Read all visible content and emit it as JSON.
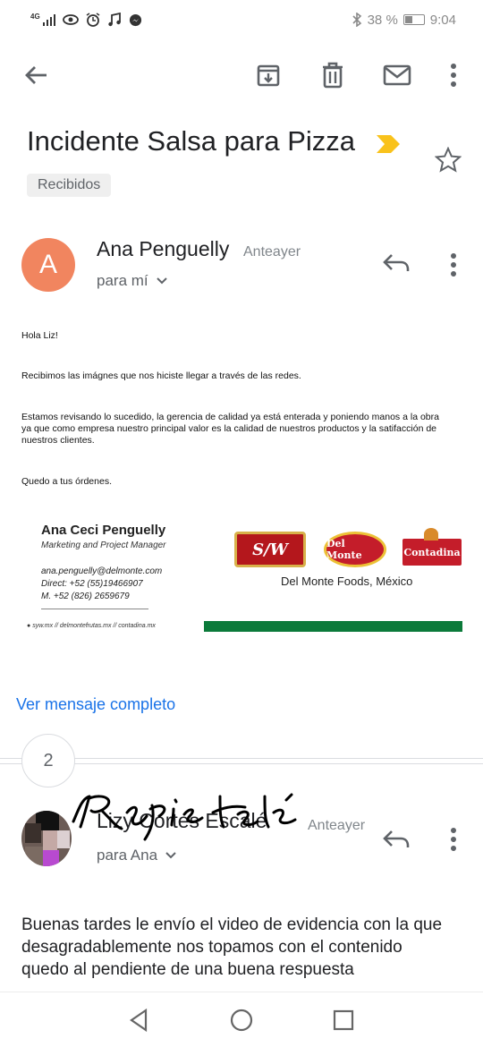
{
  "status_bar": {
    "network": "4G",
    "battery_text": "38 %",
    "time": "9:04"
  },
  "toolbar": {
    "back_icon": "arrow-left-icon",
    "archive_icon": "archive-icon",
    "delete_icon": "trash-icon",
    "mark_unread_icon": "envelope-icon",
    "more_icon": "more-vertical-icon"
  },
  "subject": {
    "title": "Incidente Salsa para Pizza",
    "label": "Recibidos",
    "importance_color": "#f9c21b"
  },
  "message1": {
    "avatar_letter": "A",
    "avatar_color": "#f1855f",
    "sender": "Ana Penguelly",
    "when": "Anteayer",
    "to": "para mí",
    "body": {
      "greeting": "Hola Liz!",
      "p1": "Recibimos las imágnes que nos hiciste llegar a través de las redes.",
      "p2_line1": "Estamos revisando lo sucedido, la gerencia de calidad ya está enterada y poniendo manos a la obra",
      "p2_line2": "ya que como empresa nuestro principal valor es la calidad de nuestros productos y la satifacción de",
      "p2_line3": "nuestros clientes.",
      "closing": "Quedo a tus órdenes."
    },
    "signature": {
      "name": "Ana Ceci Penguelly",
      "role": "Marketing and Project Manager",
      "email": "ana.penguelly@delmonte.com",
      "direct": "Direct: +52 (55)19466907",
      "mobile": "M. +52 (826) 2659679",
      "sites": "syw.mx // delmontefrutas.mx // contadina.mx",
      "company": "Del Monte Foods, México",
      "logo_sw": "S/W",
      "logo_delmonte": "Del Monte",
      "logo_contadina": "Contadina",
      "brand_green": "#0b7a3a"
    },
    "view_full": "Ver mensaje completo"
  },
  "collapsed_count": "2",
  "message2": {
    "sender": "Lizy Cortes Escalé",
    "when": "Anteayer",
    "to": "para Ana",
    "body": "Buenas tardes le envío el video de evidencia con la que desagradablemente nos topamos con el contenido quedo al pendiente de una buena respuesta"
  },
  "nav": {
    "back_icon": "triangle-back-icon",
    "home_icon": "circle-home-icon",
    "recents_icon": "square-recents-icon"
  }
}
